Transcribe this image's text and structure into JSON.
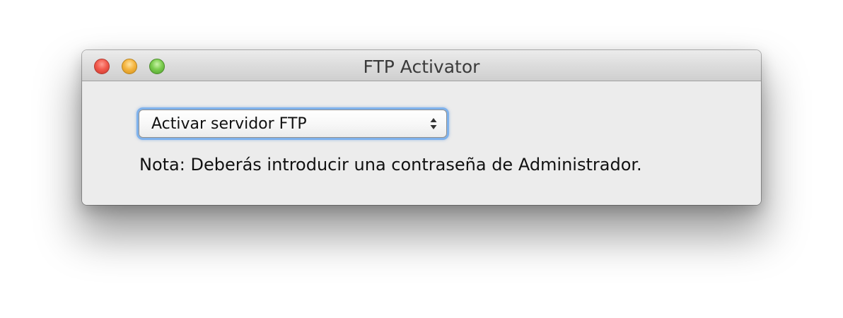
{
  "window": {
    "title": "FTP Activator",
    "controls": {
      "close": "close-icon",
      "minimize": "minimize-icon",
      "zoom": "zoom-icon"
    }
  },
  "popup": {
    "selected": "Activar servidor FTP",
    "icon": "up-down-arrows-icon",
    "focus_color": "#7fb2ec"
  },
  "note": "Nota: Deberás introducir una contraseña de Administrador.",
  "colors": {
    "close": "#f25a4d",
    "minimize": "#f5b541",
    "zoom": "#7ccd4f"
  }
}
